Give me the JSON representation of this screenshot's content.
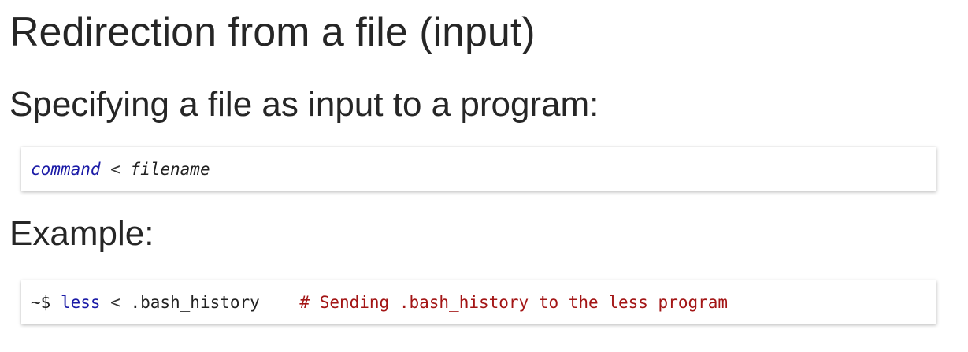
{
  "heading": {
    "title": "Redirection from a file (input)",
    "subtitle": "Specifying a file as input to a program:",
    "example_label": "Example:"
  },
  "syntax_block": {
    "command": "command",
    "operator": " < ",
    "filename": "filename"
  },
  "example_block": {
    "prompt": "~$ ",
    "program": "less",
    "operator": " < ",
    "argument": ".bash_history",
    "spacing": "    ",
    "comment": "# Sending .bash_history to the less program"
  },
  "colors": {
    "keyword": "#1a1aa6",
    "comment": "#a31515",
    "text": "#262626"
  }
}
